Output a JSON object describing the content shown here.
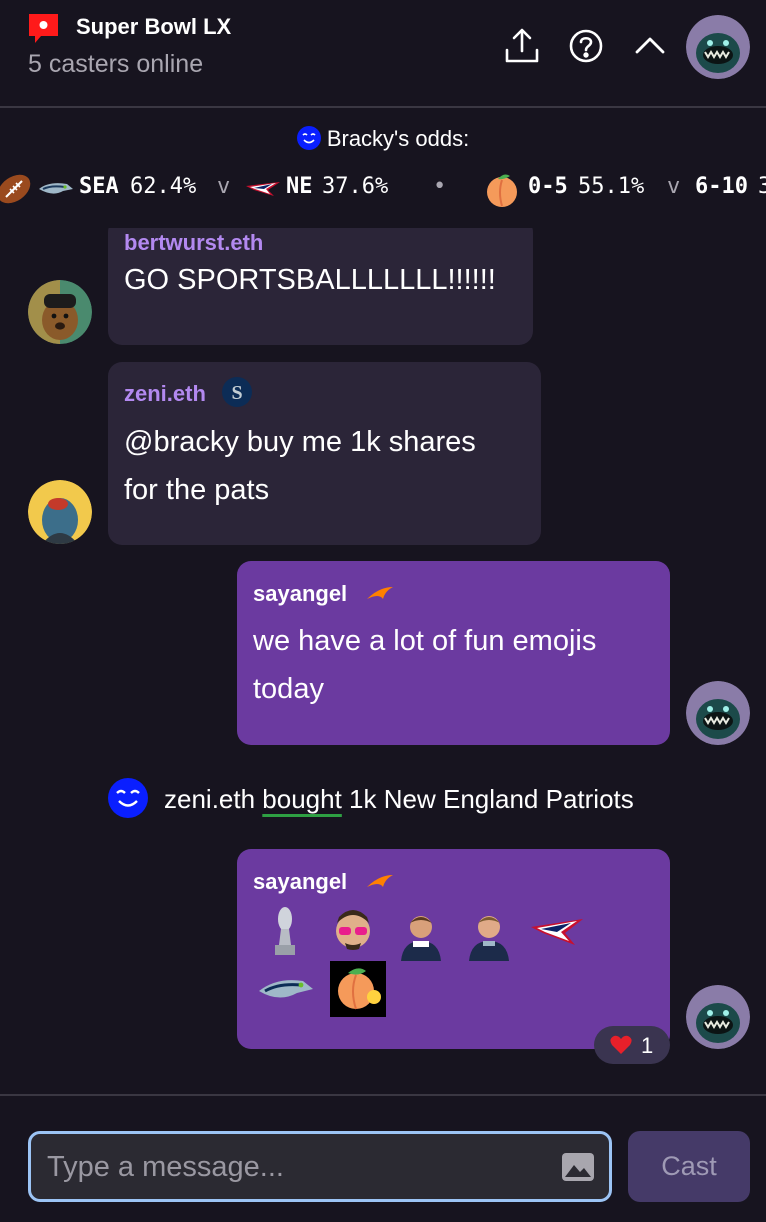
{
  "header": {
    "title": "Super Bowl LX",
    "subtitle": "5 casters online",
    "live_color": "#ff1a1a",
    "icons": [
      "share-icon",
      "help-icon",
      "chevron-up-icon",
      "avatar"
    ]
  },
  "odds": {
    "title": "Bracky's odds:",
    "ticker": {
      "match1": {
        "team1": "SEA",
        "pct1": "62.4%",
        "vs": "v",
        "team2": "NE",
        "pct2": "37.6%"
      },
      "separator": "•",
      "match2": {
        "team1": "0-5",
        "pct1": "55.1%",
        "vs": "v",
        "team2": "6-10",
        "pct2": "3"
      }
    }
  },
  "messages": [
    {
      "author": "bertwurst.eth",
      "text": "GO SPORTSBALLLLLLL!!!!!!"
    },
    {
      "author": "zeni.eth",
      "text_line1": "@bracky buy me 1k shares",
      "text_line2": "for the pats"
    },
    {
      "author": "sayangel",
      "text_line1": "we have a lot of fun emojis",
      "text_line2": "today"
    },
    {
      "author": "sayangel",
      "emojis": [
        "trophy",
        "face",
        "player1",
        "player2",
        "patriots-logo",
        "seahawks-logo",
        "peach"
      ],
      "reaction": {
        "emoji": "heart",
        "count": "1"
      }
    }
  ],
  "system": {
    "prefix": "zeni.eth ",
    "verb": "bought",
    "suffix": " 1k New England Patriots"
  },
  "composer": {
    "placeholder": "Type a message...",
    "cast_label": "Cast"
  },
  "colors": {
    "background": "#17141f",
    "bubble_other": "#2b2538",
    "bubble_mine": "#6b3aa0",
    "name_other": "#b389f0",
    "accent_blue": "#0a1fff",
    "cast_button": "#453a68"
  }
}
